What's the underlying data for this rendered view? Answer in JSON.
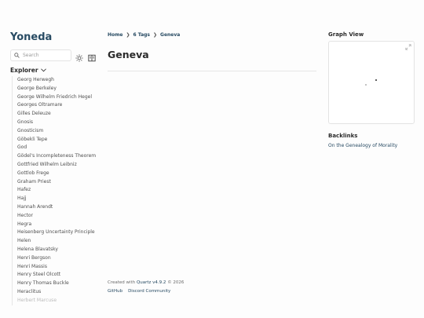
{
  "site_title": "Yoneda",
  "search": {
    "placeholder": "Search"
  },
  "explorer": {
    "title": "Explorer",
    "items": [
      "Georg Herwegh",
      "George Berkeley",
      "George Wilhelm Friedrich Hegel",
      "Georges Oltramare",
      "Gilles Deleuze",
      "Gnosis",
      "Gnosticism",
      "Göbekli Tepe",
      "God",
      "Gödel's Incompleteness Theorem",
      "Gottfried Wilhelm Leibniz",
      "Gottlob Frege",
      "Graham Priest",
      "Hafez",
      "Hajj",
      "Hannah Arendt",
      "Hector",
      "Hegra",
      "Heisenberg Uncertainty Principle",
      "Helen",
      "Helena Blavatsky",
      "Henri Bergson",
      "Henri Massis",
      "Henry Steel Olcott",
      "Henry Thomas Buckle",
      "Heraclitus",
      "Herbert Marcuse"
    ]
  },
  "breadcrumb": {
    "home": "Home",
    "tags": "6 Tags",
    "current": "Geneva"
  },
  "page_title": "Geneva",
  "footer": {
    "created_prefix": "Created with",
    "quartz_link": "Quartz v4.9.2",
    "year": "© 2026",
    "links": [
      "GitHub",
      "Discord Community"
    ]
  },
  "graph": {
    "title": "Graph View"
  },
  "backlinks": {
    "title": "Backlinks",
    "items": [
      "On the Genealogy of Morality"
    ]
  },
  "colors": {
    "accent": "#284b63",
    "text": "#2b2b2b",
    "border": "#e6e6e6"
  }
}
